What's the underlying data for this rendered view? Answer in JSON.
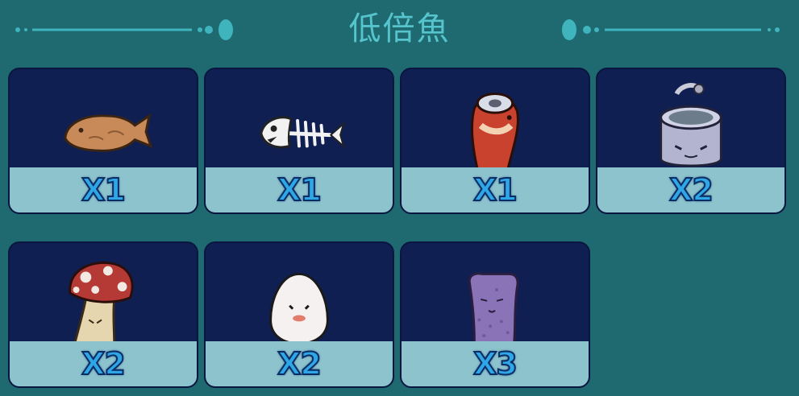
{
  "header": {
    "title": "低倍魚"
  },
  "colors": {
    "background": "#1f6a70",
    "title": "#56c4cc",
    "card_bg": "#0f1f52",
    "quantity_band": "#8cc3cd",
    "quantity_text": "#2fa6e6"
  },
  "items": [
    {
      "icon": "taiyaki-fish-icon",
      "quantity": "X1"
    },
    {
      "icon": "fish-bone-icon",
      "quantity": "X1"
    },
    {
      "icon": "soda-can-fish-icon",
      "quantity": "X1"
    },
    {
      "icon": "tin-can-icon",
      "quantity": "X2"
    },
    {
      "icon": "mushroom-icon",
      "quantity": "X2"
    },
    {
      "icon": "egg-icon",
      "quantity": "X2"
    },
    {
      "icon": "sponge-icon",
      "quantity": "X3"
    }
  ]
}
